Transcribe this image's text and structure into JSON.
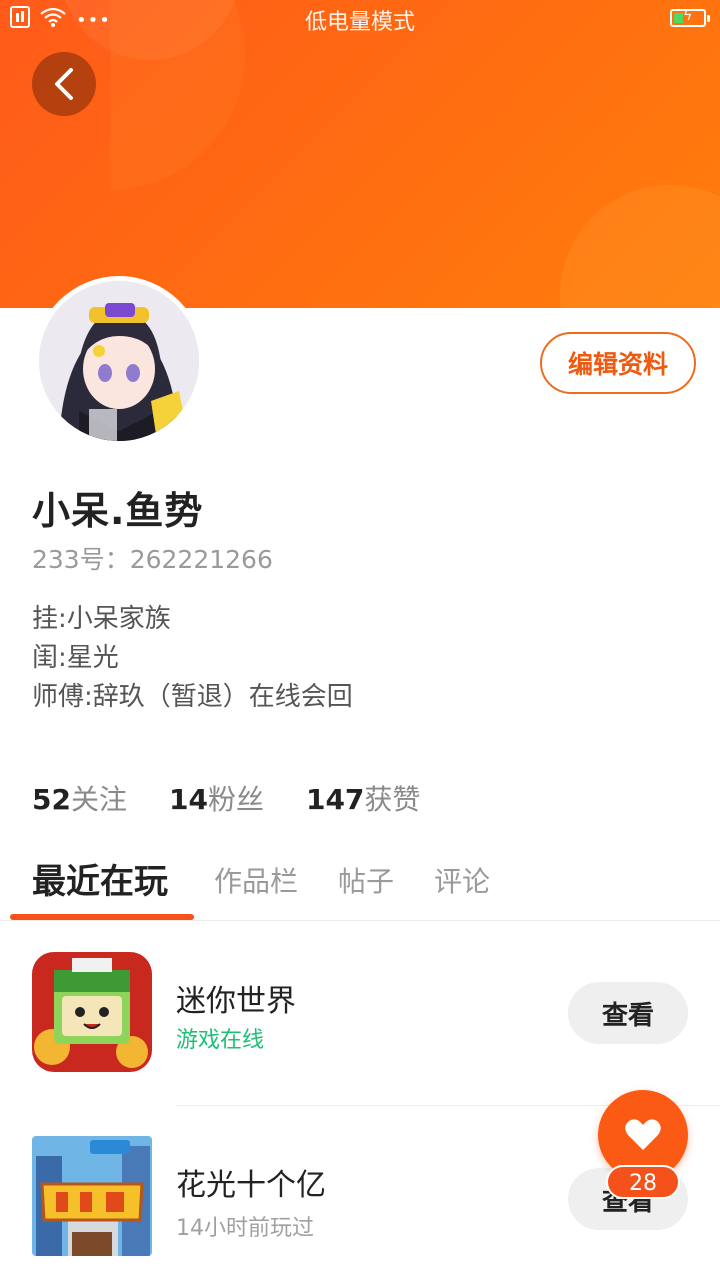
{
  "status_bar": {
    "mode_label": "低电量模式",
    "dots": "•••"
  },
  "header": {
    "accent_color": "#ff6a12"
  },
  "profile": {
    "username": "小呆.鱼势",
    "id_label": "233号：262221266",
    "bio": [
      "挂:小呆家族",
      "闺:星光",
      "师傅:辞玖（暂退）在线会回"
    ],
    "edit_button": "编辑资料"
  },
  "stats": [
    {
      "value": "52",
      "label": "关注"
    },
    {
      "value": "14",
      "label": "粉丝"
    },
    {
      "value": "147",
      "label": "获赞"
    }
  ],
  "tabs": [
    {
      "label": "最近在玩",
      "active": true
    },
    {
      "label": "作品栏",
      "active": false
    },
    {
      "label": "帖子",
      "active": false
    },
    {
      "label": "评论",
      "active": false
    }
  ],
  "games": [
    {
      "name": "迷你世界",
      "status": "游戏在线",
      "status_color": "#1fbf75",
      "button": "查看"
    },
    {
      "name": "花光十个亿",
      "status": "14小时前玩过",
      "status_color": "#a0a0a0",
      "button": "查看"
    }
  ],
  "like_fab": {
    "count": "28"
  }
}
